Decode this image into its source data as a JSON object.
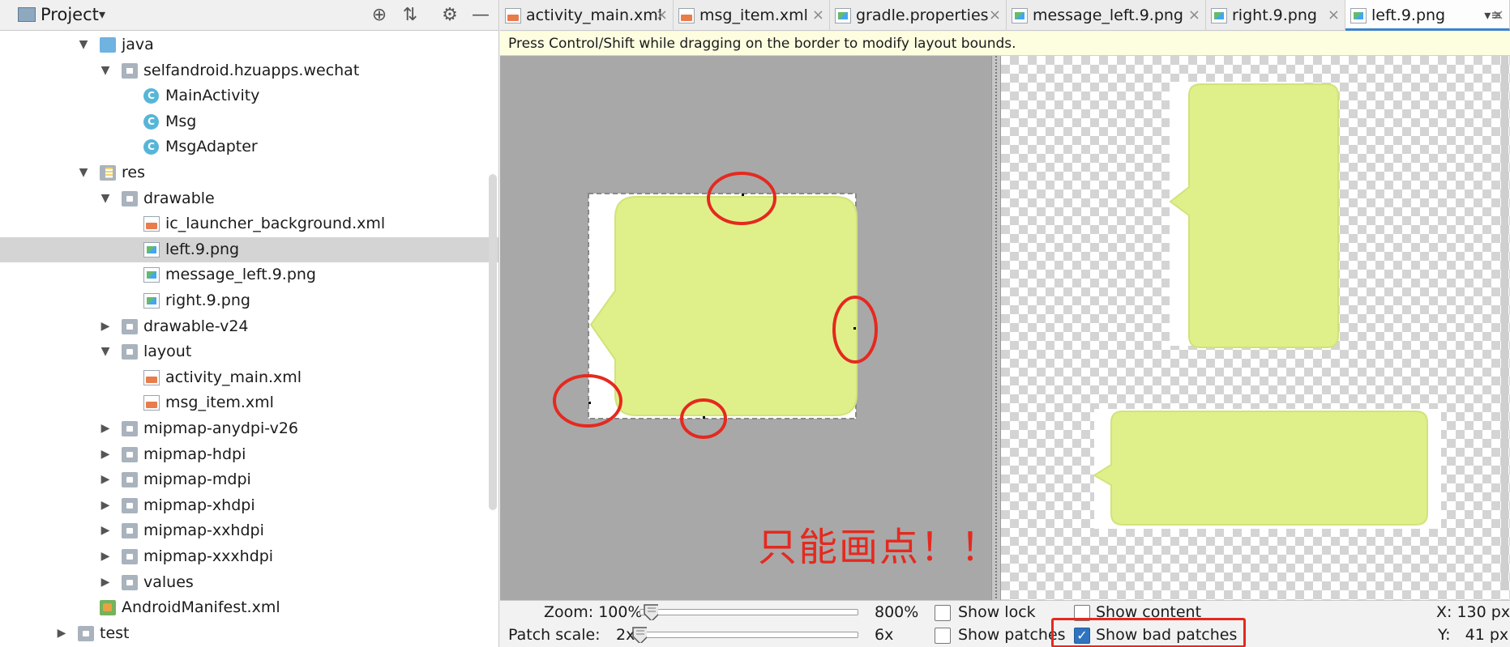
{
  "project_panel": {
    "title": "Project",
    "caret": "▾",
    "header_buttons": [
      "target-icon",
      "collapse-icon",
      "gear-icon",
      "minimize-icon"
    ],
    "tree": [
      {
        "label": "java",
        "icon": "folder-blue-icon",
        "expanded": true
      },
      {
        "label": "selfandroid.hzuapps.wechat",
        "icon": "package-icon",
        "expanded": true
      },
      {
        "label": "MainActivity",
        "icon": "class-icon"
      },
      {
        "label": "Msg",
        "icon": "class-icon"
      },
      {
        "label": "MsgAdapter",
        "icon": "class-icon"
      },
      {
        "label": "res",
        "icon": "res-folder-icon",
        "expanded": true
      },
      {
        "label": "drawable",
        "icon": "folder-icon",
        "expanded": true
      },
      {
        "label": "ic_launcher_background.xml",
        "icon": "xml-file-icon"
      },
      {
        "label": "left.9.png",
        "icon": "png-file-icon",
        "selected": true
      },
      {
        "label": "message_left.9.png",
        "icon": "png-file-icon"
      },
      {
        "label": "right.9.png",
        "icon": "png-file-icon"
      },
      {
        "label": "drawable-v24",
        "icon": "folder-icon",
        "expanded": false
      },
      {
        "label": "layout",
        "icon": "folder-icon",
        "expanded": true
      },
      {
        "label": "activity_main.xml",
        "icon": "xml-file-icon"
      },
      {
        "label": "msg_item.xml",
        "icon": "xml-file-icon"
      },
      {
        "label": "mipmap-anydpi-v26",
        "icon": "folder-icon",
        "expanded": false
      },
      {
        "label": "mipmap-hdpi",
        "icon": "folder-icon",
        "expanded": false
      },
      {
        "label": "mipmap-mdpi",
        "icon": "folder-icon",
        "expanded": false
      },
      {
        "label": "mipmap-xhdpi",
        "icon": "folder-icon",
        "expanded": false
      },
      {
        "label": "mipmap-xxhdpi",
        "icon": "folder-icon",
        "expanded": false
      },
      {
        "label": "mipmap-xxxhdpi",
        "icon": "folder-icon",
        "expanded": false
      },
      {
        "label": "values",
        "icon": "folder-icon",
        "expanded": false
      },
      {
        "label": "AndroidManifest.xml",
        "icon": "manifest-icon"
      },
      {
        "label": "test",
        "icon": "folder-icon",
        "expanded": false
      }
    ]
  },
  "tabs": [
    {
      "label": "activity_main.xml",
      "icon": "xml-file-icon",
      "active": false
    },
    {
      "label": "msg_item.xml",
      "icon": "xml-file-icon",
      "active": false
    },
    {
      "label": "gradle.properties",
      "icon": "gradle-file-icon",
      "active": false
    },
    {
      "label": "message_left.9.png",
      "icon": "png-file-icon",
      "active": false
    },
    {
      "label": "right.9.png",
      "icon": "png-file-icon",
      "active": false
    },
    {
      "label": "left.9.png",
      "icon": "png-file-icon",
      "active": true
    }
  ],
  "tab_close": "×",
  "tab_overflow": "▾≡",
  "hint": "Press Control/Shift while dragging on the border to modify layout bounds.",
  "annotation": "只能画点！！",
  "controls": {
    "zoom_label": "Zoom: 100%",
    "zoom_max": "800%",
    "zoom_value_fraction": 0.02,
    "patch_scale_label": "Patch scale:",
    "patch_scale_min": "2x",
    "patch_scale_max": "6x",
    "patch_scale_value_fraction": 0.0,
    "show_lock": {
      "label": "Show lock",
      "checked": false
    },
    "show_patches": {
      "label": "Show patches",
      "checked": false
    },
    "show_content": {
      "label": "Show content",
      "checked": false
    },
    "show_bad_patches": {
      "label": "Show bad patches",
      "checked": true
    },
    "x_readout": "X: 130 px",
    "y_readout": "Y:   41 px"
  },
  "colors": {
    "bubble": "#dff08a",
    "annotation_red": "#e5291f",
    "tab_active_underline": "#4083c9"
  }
}
